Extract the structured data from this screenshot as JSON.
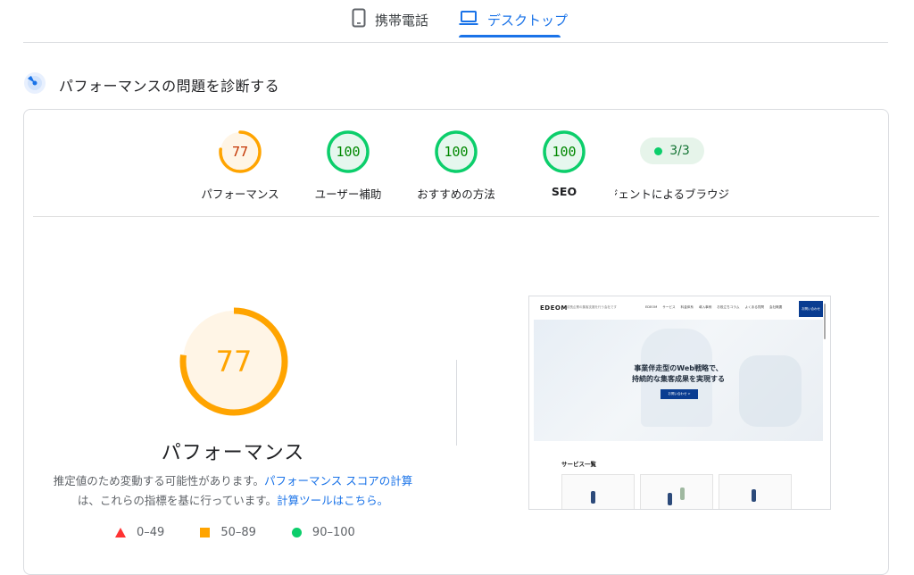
{
  "tabs": {
    "mobile_label": "携帯電話",
    "desktop_label": "デスクトップ",
    "active": "desktop"
  },
  "section": {
    "title": "パフォーマンスの問題を診断する"
  },
  "scores": [
    {
      "label": "パフォーマンス",
      "value": "77",
      "status": "average"
    },
    {
      "label": "ユーザー補助",
      "value": "100",
      "status": "pass"
    },
    {
      "label": "おすすめの方法",
      "value": "100",
      "status": "pass"
    },
    {
      "label": "SEO",
      "value": "100",
      "status": "pass"
    }
  ],
  "agent": {
    "value": "3/3",
    "label": "ジェントによるブラウジ"
  },
  "main": {
    "score": "77",
    "title": "パフォーマンス",
    "desc_prefix": "推定値のため変動する可能性があります。",
    "desc_link1": "パフォーマンス スコアの計算",
    "desc_middle": "は、これらの指標を基に行っています。",
    "desc_link2": "計算ツールはこちら。"
  },
  "legend": [
    {
      "range": "0–49",
      "shape": "triangle",
      "color": "#ff3333"
    },
    {
      "range": "50–89",
      "shape": "square",
      "color": "#ffa400"
    },
    {
      "range": "90–100",
      "shape": "circle",
      "color": "#0cce6b"
    }
  ],
  "screenshot": {
    "logo": "EDEOM",
    "logo_sub": "成長企業の集客支援を行う会社です",
    "menu": [
      "EDEOM",
      "サービス",
      "料金体系",
      "導入事例",
      "お役立ちコラム",
      "よくある質問",
      "会社概要"
    ],
    "cta": "お問い合わせ",
    "hero_line1": "事業伴走型のWeb戦略で、",
    "hero_line2": "持続的な集客成果を実現する",
    "hero_button": "お問い合わせ  >",
    "services_title": "サービス一覧"
  },
  "colors": {
    "accent": "#1a73e8",
    "pass": "#0cce6b",
    "average": "#ffa400",
    "fail": "#ff3333"
  },
  "icons": {
    "mobile": "phone-icon",
    "desktop": "laptop-icon",
    "section": "performance-radar-icon"
  }
}
